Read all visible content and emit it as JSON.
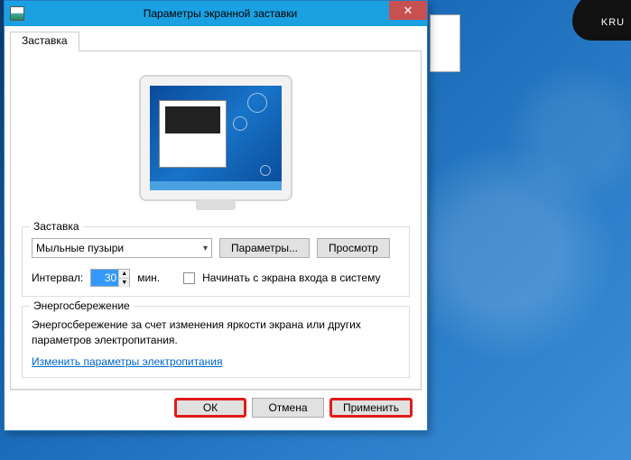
{
  "titlebar": {
    "title": "Параметры экранной заставки"
  },
  "tab": {
    "label": "Заставка"
  },
  "screensaver_group": {
    "label": "Заставка",
    "selected": "Мыльные пузыри",
    "params_btn": "Параметры...",
    "preview_btn": "Просмотр",
    "interval_label": "Интервал:",
    "interval_value": "30",
    "interval_unit": "мин.",
    "login_checkbox_label": "Начинать с экрана входа в систему"
  },
  "power_group": {
    "label": "Энергосбережение",
    "text": "Энергосбережение за счет изменения яркости экрана или других параметров электропитания.",
    "link": "Изменить параметры электропитания"
  },
  "buttons": {
    "ok": "ОК",
    "cancel": "Отмена",
    "apply": "Применить"
  },
  "desktop": {
    "device_label": "KRU"
  }
}
